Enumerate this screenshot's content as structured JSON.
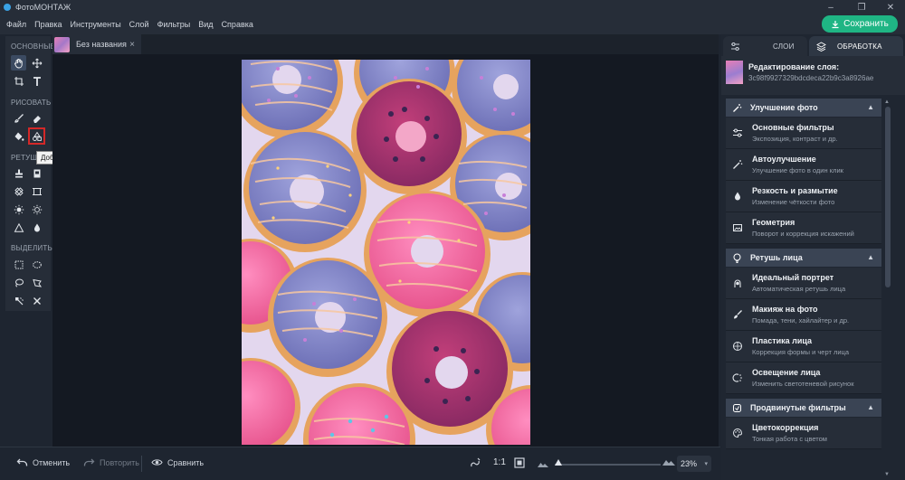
{
  "app": {
    "title": "ФотоМОНТАЖ"
  },
  "menu": [
    "Файл",
    "Правка",
    "Инструменты",
    "Слой",
    "Фильтры",
    "Вид",
    "Справка"
  ],
  "save_button": "Сохранить",
  "toolbar": {
    "sections": [
      "ОСНОВНЫЕ",
      "РИСОВАТЬ",
      "РЕТУШ",
      "ВЫДЕЛИТЬ"
    ],
    "tooltip": "Добавить фигуры"
  },
  "document": {
    "tab_name": "Без названия",
    "close": "×"
  },
  "bottom": {
    "undo": "Отменить",
    "redo": "Повторить",
    "compare": "Сравнить",
    "actual_size": "1:1",
    "zoom": "23%",
    "zoom_fraction": 0.03
  },
  "right_panel": {
    "tab_layers": "СЛОИ",
    "tab_processing": "ОБРАБОТКА",
    "layer_title": "Редактирование слоя:",
    "layer_hash": "3c98f9927329bdcdeca22b9c3a8926ae",
    "sections": [
      {
        "title": "Улучшение фото",
        "icon": "magic-wand-icon",
        "items": [
          {
            "title": "Основные фильтры",
            "desc": "Экспозиция, контраст и др.",
            "icon": "sliders-icon"
          },
          {
            "title": "Автоулучшение",
            "desc": "Улучшение фото в один клик",
            "icon": "magic-wand-icon"
          },
          {
            "title": "Резкость и размытие",
            "desc": "Изменение чёткости фото",
            "icon": "droplet-icon"
          },
          {
            "title": "Геометрия",
            "desc": "Поворот и коррекция искажений",
            "icon": "image-frame-icon"
          }
        ]
      },
      {
        "title": "Ретушь лица",
        "icon": "face-bulb-icon",
        "items": [
          {
            "title": "Идеальный портрет",
            "desc": "Автоматическая ретушь лица",
            "icon": "portrait-icon"
          },
          {
            "title": "Макияж на фото",
            "desc": "Помада, тени, хайлайтер и др.",
            "icon": "makeup-brush-icon"
          },
          {
            "title": "Пластика лица",
            "desc": "Коррекция формы и черт лица",
            "icon": "face-shape-icon"
          },
          {
            "title": "Освещение лица",
            "desc": "Изменить светотеневой рисунок",
            "icon": "face-light-icon"
          }
        ]
      },
      {
        "title": "Продвинутые фильтры",
        "icon": "filter-icon",
        "items": [
          {
            "title": "Цветокоррекция",
            "desc": "Тонкая работа с цветом",
            "icon": "palette-icon"
          }
        ]
      }
    ]
  }
}
